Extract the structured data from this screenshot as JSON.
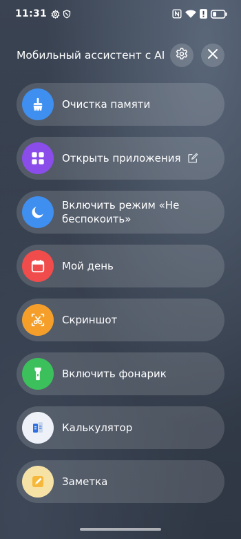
{
  "status_bar": {
    "time": "11:31",
    "left_icons": [
      "gear-icon",
      "shield-icon"
    ],
    "right_icons": [
      "nfc-icon",
      "wifi-icon",
      "alert-icon",
      "battery-icon"
    ]
  },
  "header": {
    "title": "Мобильный ассистент с AI",
    "settings_icon": "gear-icon",
    "close_icon": "close-icon"
  },
  "actions": [
    {
      "label": "Очистка памяти",
      "icon": "broom-icon",
      "color": "#3e8ff0"
    },
    {
      "label": "Открыть приложения",
      "icon": "apps-grid-icon",
      "color": "#8a4dea",
      "has_edit": true
    },
    {
      "label": "Включить режим «Не беспокоить»",
      "icon": "moon-icon",
      "color": "#3e8ff0"
    },
    {
      "label": "Мой день",
      "icon": "calendar-icon",
      "color": "#f04c4c"
    },
    {
      "label": "Скриншот",
      "icon": "scissors-icon",
      "color": "#f59f2a"
    },
    {
      "label": "Включить фонарик",
      "icon": "flashlight-icon",
      "color": "#3cc05c"
    },
    {
      "label": "Калькулятор",
      "icon": "calculator-icon",
      "color": "#eef2f8"
    },
    {
      "label": "Заметка",
      "icon": "note-icon",
      "color": "#f7e2a6"
    }
  ]
}
